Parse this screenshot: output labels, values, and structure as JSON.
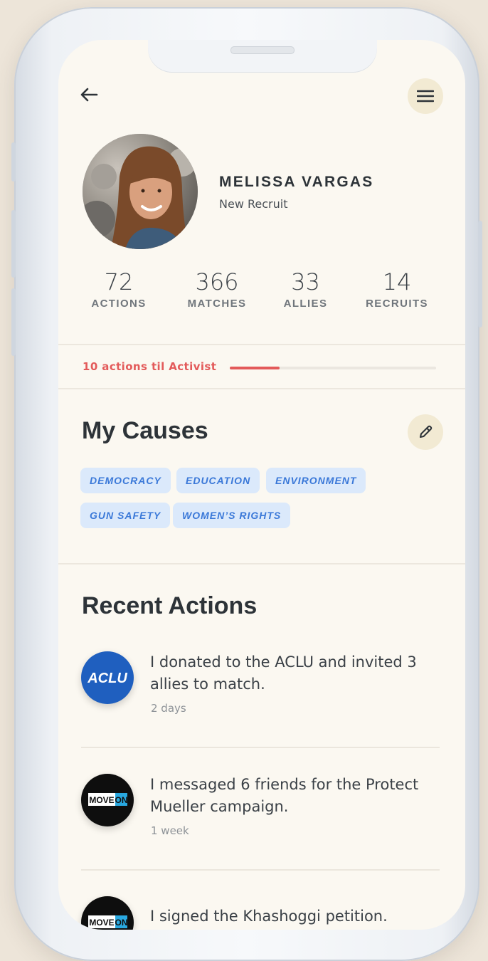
{
  "profile": {
    "name": "MELISSA VARGAS",
    "rank": "New Recruit"
  },
  "stats": [
    {
      "value": "72",
      "label": "ACTIONS"
    },
    {
      "value": "366",
      "label": "MATCHES"
    },
    {
      "value": "33",
      "label": "ALLIES"
    },
    {
      "value": "14",
      "label": "RECRUITS"
    }
  ],
  "progress": {
    "label": "10 actions til Activist",
    "fraction": 0.24,
    "color": "#e35a5a"
  },
  "causes": {
    "title": "My Causes",
    "tags": [
      "DEMOCRACY",
      "EDUCATION",
      "ENVIRONMENT",
      "GUN SAFETY",
      "WOMEN’S RIGHTS"
    ]
  },
  "recent": {
    "title": "Recent Actions",
    "items": [
      {
        "logo": "ACLU",
        "text": "I donated to the ACLU and invited 3 allies to match.",
        "time": "2 days"
      },
      {
        "logo": "MOVEON",
        "text": "I messaged 6 friends for the Protect Mueller campaign.",
        "time": "1 week"
      },
      {
        "logo": "MOVEON",
        "text": "I signed the Khashoggi petition.",
        "time": ""
      }
    ]
  },
  "icons": {
    "back": "back-arrow-icon",
    "menu": "hamburger-menu-icon",
    "edit": "pencil-icon"
  },
  "colors": {
    "background": "#fbf8f1",
    "accent": "#e35a5a",
    "chip_bg": "#dbe9fb",
    "chip_text": "#3a78d8",
    "icon_button_bg": "#f2ead3",
    "aclu_blue": "#1f5fbf"
  }
}
